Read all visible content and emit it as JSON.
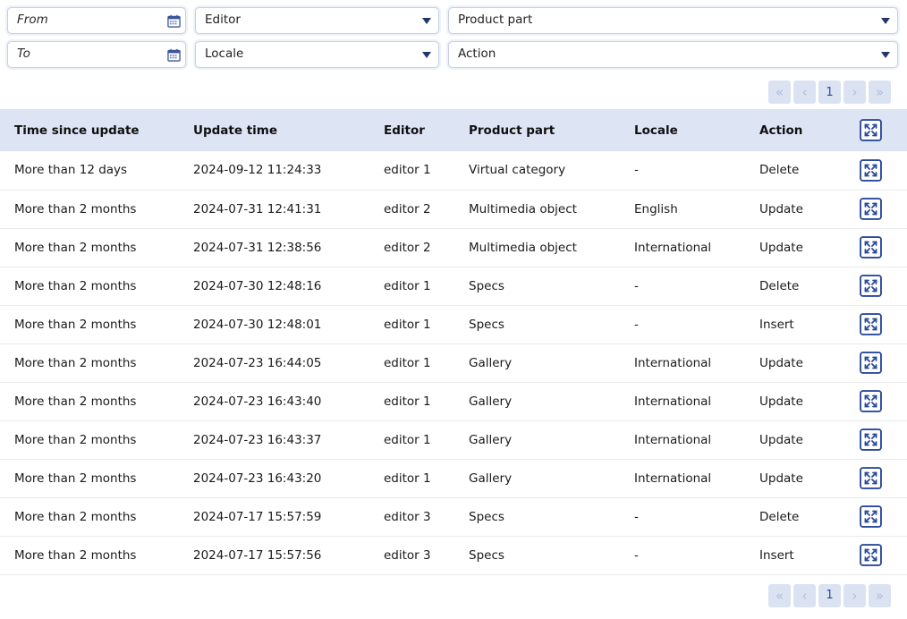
{
  "filters": {
    "from": {
      "placeholder": "From",
      "value": "",
      "icon": "calendar-icon"
    },
    "to": {
      "placeholder": "To",
      "value": "",
      "icon": "calendar-icon"
    },
    "editor": {
      "label": "Editor",
      "value": "Editor"
    },
    "locale": {
      "label": "Locale",
      "value": "Locale"
    },
    "product_part": {
      "label": "Product part",
      "value": "Product part"
    },
    "action": {
      "label": "Action",
      "value": "Action"
    }
  },
  "pagination": {
    "first": "«",
    "prev": "‹",
    "page": "1",
    "next": "›",
    "last": "»"
  },
  "table": {
    "columns": [
      "Time since update",
      "Update time",
      "Editor",
      "Product part",
      "Locale",
      "Action",
      ""
    ],
    "header_action_icon": "expand-icon",
    "row_action_icon": "expand-icon",
    "rows": [
      {
        "time_since_update": "More than 12 days",
        "update_time": "2024-09-12 11:24:33",
        "editor": "editor 1",
        "product_part": "Virtual category",
        "locale": "-",
        "action": "Delete"
      },
      {
        "time_since_update": "More than 2 months",
        "update_time": "2024-07-31 12:41:31",
        "editor": "editor 2",
        "product_part": "Multimedia object",
        "locale": "English",
        "action": "Update"
      },
      {
        "time_since_update": "More than 2 months",
        "update_time": "2024-07-31 12:38:56",
        "editor": "editor 2",
        "product_part": "Multimedia object",
        "locale": "International",
        "action": "Update"
      },
      {
        "time_since_update": "More than 2 months",
        "update_time": "2024-07-30 12:48:16",
        "editor": "editor 1",
        "product_part": "Specs",
        "locale": "-",
        "action": "Delete"
      },
      {
        "time_since_update": "More than 2 months",
        "update_time": "2024-07-30 12:48:01",
        "editor": "editor 1",
        "product_part": "Specs",
        "locale": "-",
        "action": "Insert"
      },
      {
        "time_since_update": "More than 2 months",
        "update_time": "2024-07-23 16:44:05",
        "editor": "editor 1",
        "product_part": "Gallery",
        "locale": "International",
        "action": "Update"
      },
      {
        "time_since_update": "More than 2 months",
        "update_time": "2024-07-23 16:43:40",
        "editor": "editor 1",
        "product_part": "Gallery",
        "locale": "International",
        "action": "Update"
      },
      {
        "time_since_update": "More than 2 months",
        "update_time": "2024-07-23 16:43:37",
        "editor": "editor 1",
        "product_part": "Gallery",
        "locale": "International",
        "action": "Update"
      },
      {
        "time_since_update": "More than 2 months",
        "update_time": "2024-07-23 16:43:20",
        "editor": "editor 1",
        "product_part": "Gallery",
        "locale": "International",
        "action": "Update"
      },
      {
        "time_since_update": "More than 2 months",
        "update_time": "2024-07-17 15:57:59",
        "editor": "editor 3",
        "product_part": "Specs",
        "locale": "-",
        "action": "Delete"
      },
      {
        "time_since_update": "More than 2 months",
        "update_time": "2024-07-17 15:57:56",
        "editor": "editor 3",
        "product_part": "Specs",
        "locale": "-",
        "action": "Insert"
      }
    ]
  },
  "colors": {
    "header_bg": "#dde4f4",
    "pager_bg": "#dbe3f3",
    "accent": "#2b4a9b",
    "border": "#c7cfe6"
  }
}
